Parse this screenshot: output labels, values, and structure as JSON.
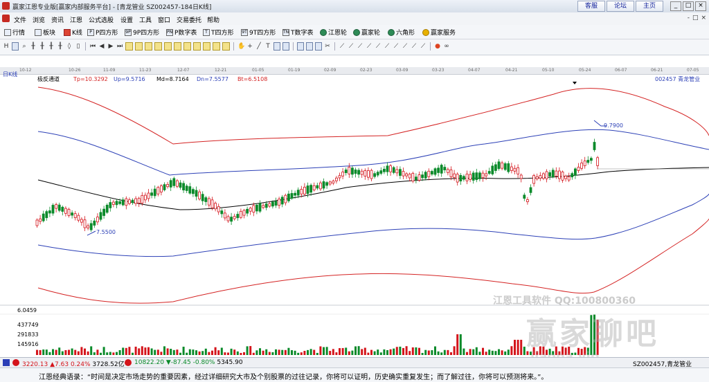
{
  "window": {
    "title": "赢家江恩专业版[赢家内部服务平台] - [青龙管业  SZ002457-184日K线]"
  },
  "top_buttons": [
    "客服",
    "论坛",
    "主页"
  ],
  "window_controls": [
    "_",
    "□",
    "×"
  ],
  "menu": [
    "文件",
    "浏览",
    "资讯",
    "江恩",
    "公式选股",
    "设置",
    "工具",
    "窗口",
    "交易委托",
    "帮助"
  ],
  "mdi_controls": [
    "-",
    "□",
    "×"
  ],
  "toolbar1": [
    "行情",
    "板块",
    "K线",
    "P四方形",
    "9P四方形",
    "P数字表",
    "T四方形",
    "9T四方形",
    "T数字表",
    "江恩轮",
    "赢家轮",
    "六角形",
    "赢家服务"
  ],
  "toolbar1_badges": [
    "P",
    "9P",
    "PN",
    "T",
    "9T",
    "TN"
  ],
  "period_label": "日K线",
  "dates": [
    "10-12",
    "10-26",
    "11-09",
    "11-23",
    "12-07",
    "12-21",
    "01-05",
    "01-19",
    "02-09",
    "02-23",
    "03-09",
    "03-23",
    "04-07",
    "04-21",
    "05-10",
    "05-24",
    "06-07",
    "06-21",
    "07-05"
  ],
  "indicator": {
    "name": "极反通道",
    "tp": "Tp=10.3292",
    "up": "Up=9.5716",
    "md": "Md=8.7164",
    "dn": "Dn=7.5577",
    "bt": "Bt=6.5108"
  },
  "stock_label": "002457  青龙管业",
  "price_high_label": "9.7900",
  "price_low_label": "7.5500",
  "volume_axis": [
    "6.0459",
    "437749",
    "291833",
    "145916"
  ],
  "colors": {
    "up": "#d4141b",
    "down": "#0a8a2a",
    "outer_band": "#d42222",
    "inner_band": "#2b3fb6",
    "mid": "#000000"
  },
  "chart_data": {
    "type": "candlestick",
    "title": "青龙管业 002457 日K线",
    "close_start": 7.6,
    "close_end": 9.2,
    "high_mark": 9.79,
    "low_mark": 7.55,
    "channel": {
      "Tp": 10.3292,
      "Up": 9.5716,
      "Md": 8.7164,
      "Dn": 7.5577,
      "Bt": 6.5108
    }
  },
  "watermark": {
    "text": "江恩工具软件 QQ:100800360",
    "logo": "赢家聊吧",
    "url": "liaoba.vip"
  },
  "status": {
    "sh_index": "3220.13",
    "sh_change": "▲7.63",
    "sh_pct": "0.24%",
    "sh_amount": "3728.52亿",
    "sz_index": "10822.20",
    "sz_change": "▼-87.45",
    "sz_pct": "-0.80%",
    "sz_amount": "5345.90",
    "stock": "SZ002457,青龙管业"
  },
  "quote": "江恩经典语录：“时间是决定市场走势的重要因素，经过详细研究大市及个别股票的过往记录，你将可以证明，历史确实重复发生；而了解过往，你将可以预测将来。”。"
}
